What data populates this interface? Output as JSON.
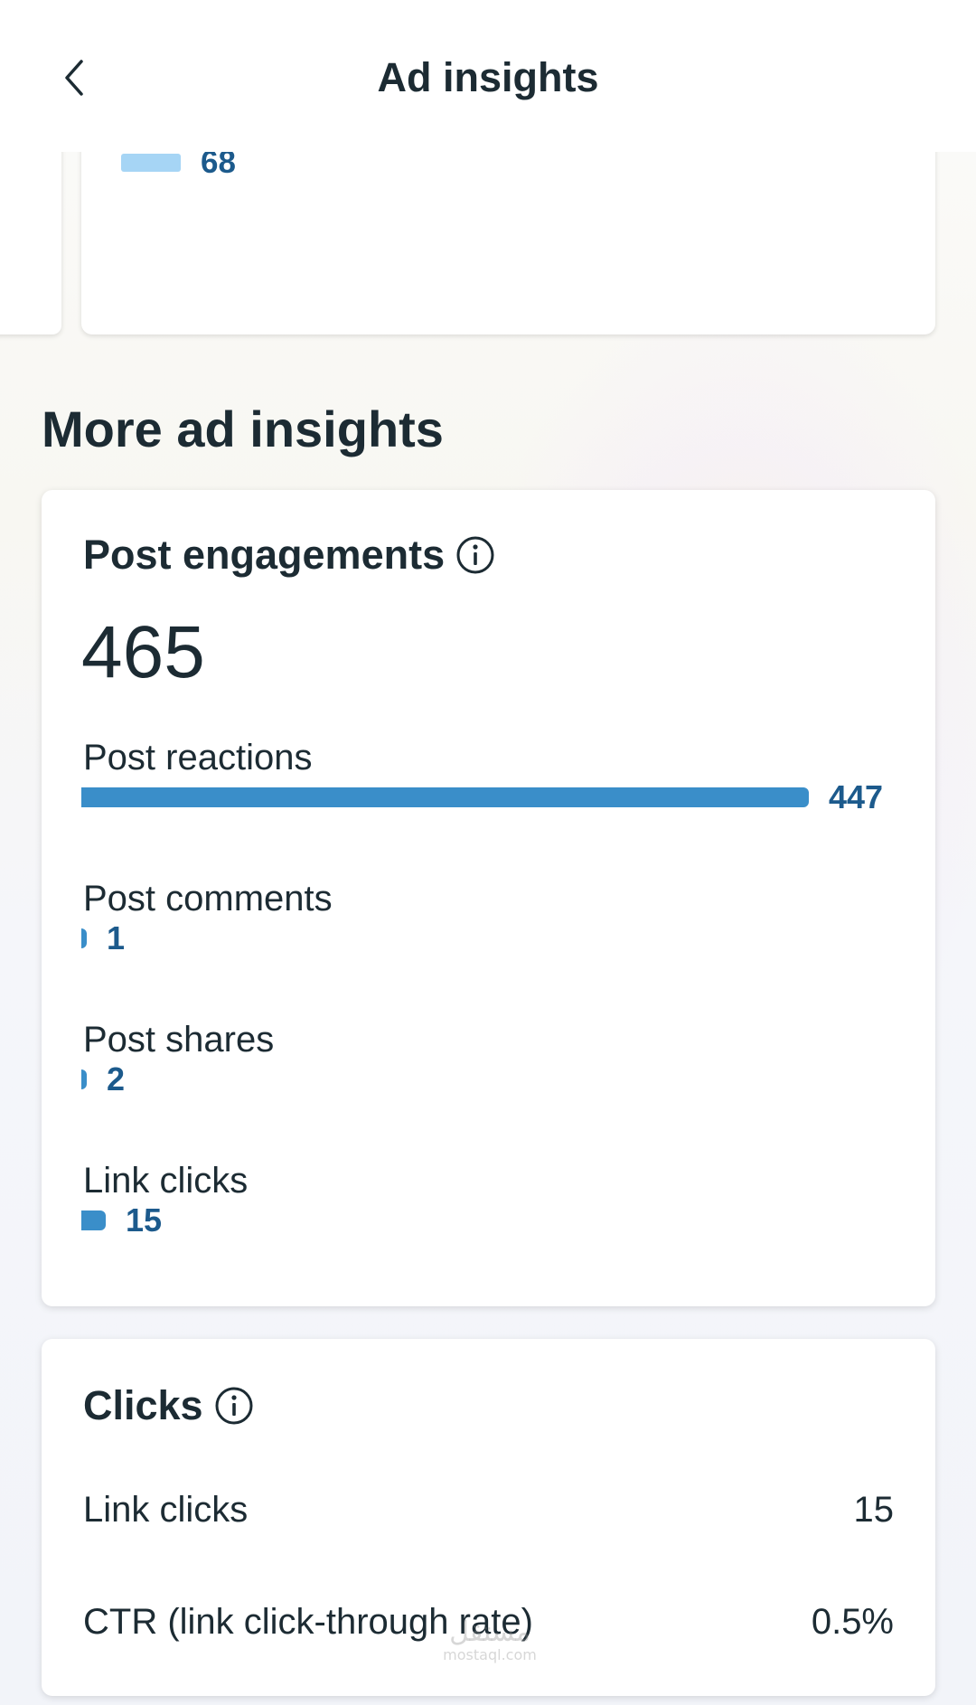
{
  "header": {
    "title": "Ad insights",
    "back_icon": "chevron-left-icon"
  },
  "previous_card": {
    "value": "68",
    "bar_color": "#a6d5f5"
  },
  "section_heading": "More ad insights",
  "post_engagements": {
    "title": "Post engagements",
    "info_icon": "info-icon",
    "total": "465",
    "bar_color": "#3a8ec9",
    "value_color": "#1c5a8c",
    "metrics": [
      {
        "label": "Post reactions",
        "value": "447",
        "count": 447
      },
      {
        "label": "Post comments",
        "value": "1",
        "count": 1
      },
      {
        "label": "Post shares",
        "value": "2",
        "count": 2
      },
      {
        "label": "Link clicks",
        "value": "15",
        "count": 15
      }
    ]
  },
  "clicks": {
    "title": "Clicks",
    "info_icon": "info-icon",
    "rows": [
      {
        "label": "Link clicks",
        "value": "15"
      },
      {
        "label": "CTR (link click-through rate)",
        "value": "0.5%"
      }
    ]
  },
  "watermark": {
    "main": "مستقل",
    "sub": "mostaql.com"
  }
}
